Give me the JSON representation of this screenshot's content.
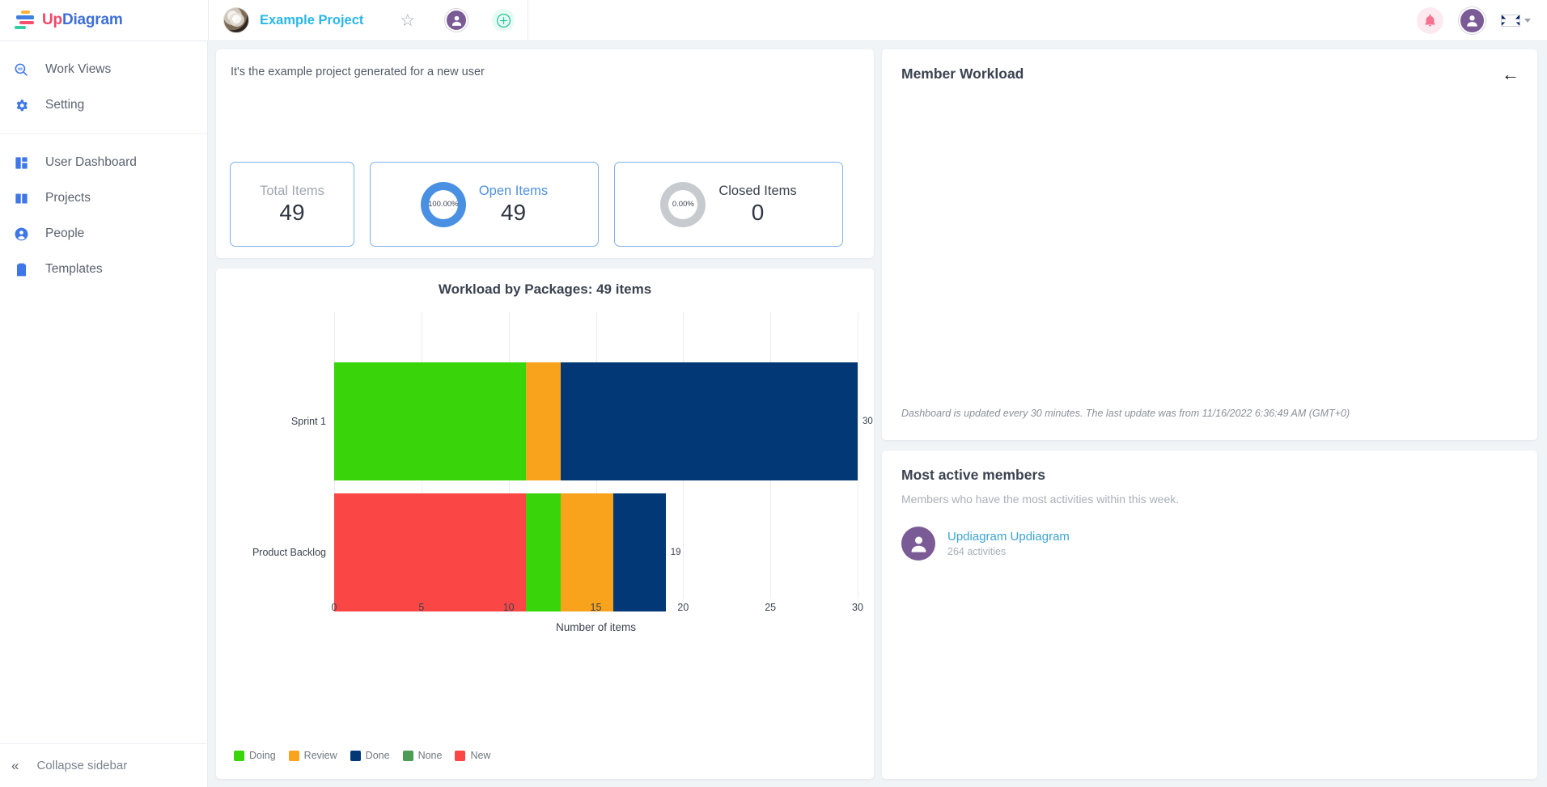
{
  "app": {
    "logo_up": "Up",
    "logo_diagram": "Diagram"
  },
  "topbar": {
    "project_name": "Example Project",
    "star_icon": "star-outline-icon",
    "member_icon": "user-icon",
    "add_icon": "plus-circle-icon",
    "bell_icon": "bell-icon",
    "avatar_icon": "user-avatar-icon",
    "language_flag": "uk-flag-icon",
    "language_caret": "chevron-down-icon"
  },
  "sidebar": {
    "groups": [
      {
        "items": [
          {
            "label": "Work Views",
            "icon": "magnifier-icon"
          },
          {
            "label": "Setting",
            "icon": "gear-icon"
          }
        ]
      },
      {
        "items": [
          {
            "label": "User Dashboard",
            "icon": "dashboard-grid-icon"
          },
          {
            "label": "Projects",
            "icon": "book-icon"
          },
          {
            "label": "People",
            "icon": "person-circle-icon"
          },
          {
            "label": "Templates",
            "icon": "clipboard-icon"
          }
        ]
      }
    ],
    "collapse_label": "Collapse sidebar",
    "collapse_icon": "double-chevron-left-icon"
  },
  "summary": {
    "description": "It's the example project generated for a new user",
    "stats": [
      {
        "title": "Total Items",
        "value": "49",
        "percent": null,
        "donut_color": null
      },
      {
        "title": "Open Items",
        "value": "49",
        "percent": "100.00%",
        "donut_color": "#4a90e2"
      },
      {
        "title": "Closed Items",
        "value": "0",
        "percent": "0.00%",
        "donut_color": "#c7cbcf"
      }
    ]
  },
  "chart_data": {
    "type": "bar",
    "orientation": "horizontal",
    "stacked": true,
    "title": "Workload by Packages: 49 items",
    "xlabel": "Number of items",
    "ylabel": "",
    "categories": [
      "Sprint 1",
      "Product Backlog"
    ],
    "totals": [
      30,
      19
    ],
    "xlim": [
      0,
      30
    ],
    "xticks": [
      0,
      5,
      10,
      15,
      20,
      25,
      30
    ],
    "grid": true,
    "legend_position": "bottom-left",
    "series": [
      {
        "name": "Doing",
        "color": "#39d50a",
        "values": [
          11,
          2
        ]
      },
      {
        "name": "Review",
        "color": "#f9a21b",
        "values": [
          2,
          3
        ]
      },
      {
        "name": "Done",
        "color": "#033876",
        "values": [
          17,
          3
        ]
      },
      {
        "name": "None",
        "color": "#4b9d54",
        "values": [
          0,
          0
        ]
      },
      {
        "name": "New",
        "color": "#fb4646",
        "values": [
          0,
          11
        ]
      }
    ],
    "bar_order": [
      {
        "category": "Sprint 1",
        "segments": [
          {
            "name": "Doing",
            "value": 11
          },
          {
            "name": "Review",
            "value": 2
          },
          {
            "name": "Done",
            "value": 17
          }
        ]
      },
      {
        "category": "Product Backlog",
        "segments": [
          {
            "name": "New",
            "value": 11
          },
          {
            "name": "Doing",
            "value": 2
          },
          {
            "name": "Review",
            "value": 3
          },
          {
            "name": "Done",
            "value": 3
          }
        ]
      }
    ]
  },
  "member_workload": {
    "title": "Member Workload",
    "back_icon": "arrow-left-icon",
    "update_note": "Dashboard is updated every 30 minutes. The last update was from 11/16/2022 6:36:49 AM (GMT+0)"
  },
  "most_active": {
    "title": "Most active members",
    "subtitle": "Members who have the most activities within this week.",
    "members": [
      {
        "name": "Updiagram Updiagram",
        "activities": "264 activities",
        "avatar_icon": "user-avatar-icon"
      }
    ]
  }
}
